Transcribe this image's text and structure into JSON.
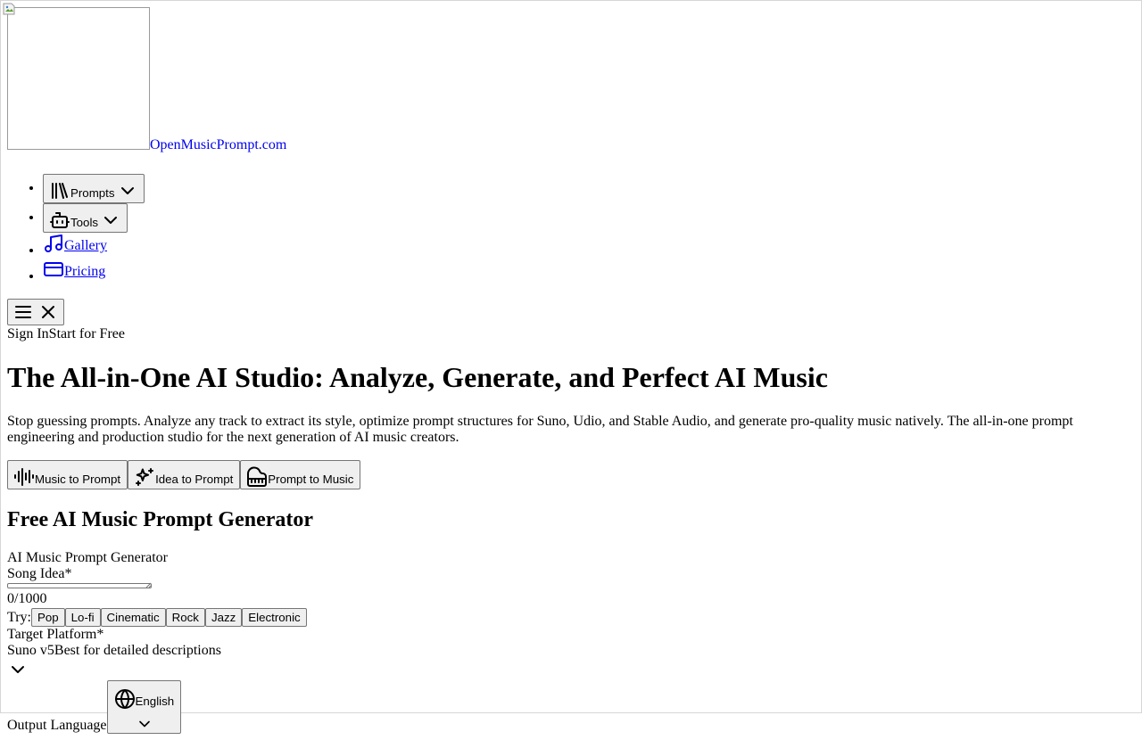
{
  "brand": {
    "name": "OpenMusicPrompt.com"
  },
  "nav": {
    "items": [
      {
        "label": "Prompts",
        "icon": "library-icon",
        "type": "dropdown"
      },
      {
        "label": "Tools",
        "icon": "bot-icon",
        "type": "dropdown"
      },
      {
        "label": "Gallery",
        "icon": "music-note-icon",
        "type": "link"
      },
      {
        "label": "Pricing",
        "icon": "credit-card-icon",
        "type": "link"
      }
    ]
  },
  "auth": {
    "sign_in": "Sign In",
    "start_free": "Start for Free"
  },
  "hero": {
    "title": "The All-in-One AI Studio: Analyze, Generate, and Perfect AI Music",
    "subtitle": "Stop guessing prompts. Analyze any track to extract its style, optimize prompt structures for Suno, Udio, and Stable Audio, and generate pro-quality music natively. The all-in-one prompt engineering and production studio for the next generation of AI music creators."
  },
  "modes": [
    {
      "label": "Music to Prompt",
      "icon": "audio-waveform-icon"
    },
    {
      "label": "Idea to Prompt",
      "icon": "sparkles-icon"
    },
    {
      "label": "Prompt to Music",
      "icon": "piano-icon"
    }
  ],
  "generator": {
    "heading": "Free AI Music Prompt Generator",
    "form_title": "AI Music Prompt Generator",
    "song_idea_label": "Song Idea",
    "required_mark": "*",
    "song_idea_value": "",
    "counter": "0/1000",
    "try_label": "Try:",
    "try_chips": [
      "Pop",
      "Lo-fi",
      "Cinematic",
      "Rock",
      "Jazz",
      "Electronic"
    ],
    "platform_label": "Target Platform",
    "platform_value": "Suno v5",
    "platform_hint": "Best for detailed descriptions",
    "language_label": "Output Language",
    "language_value": "English"
  }
}
